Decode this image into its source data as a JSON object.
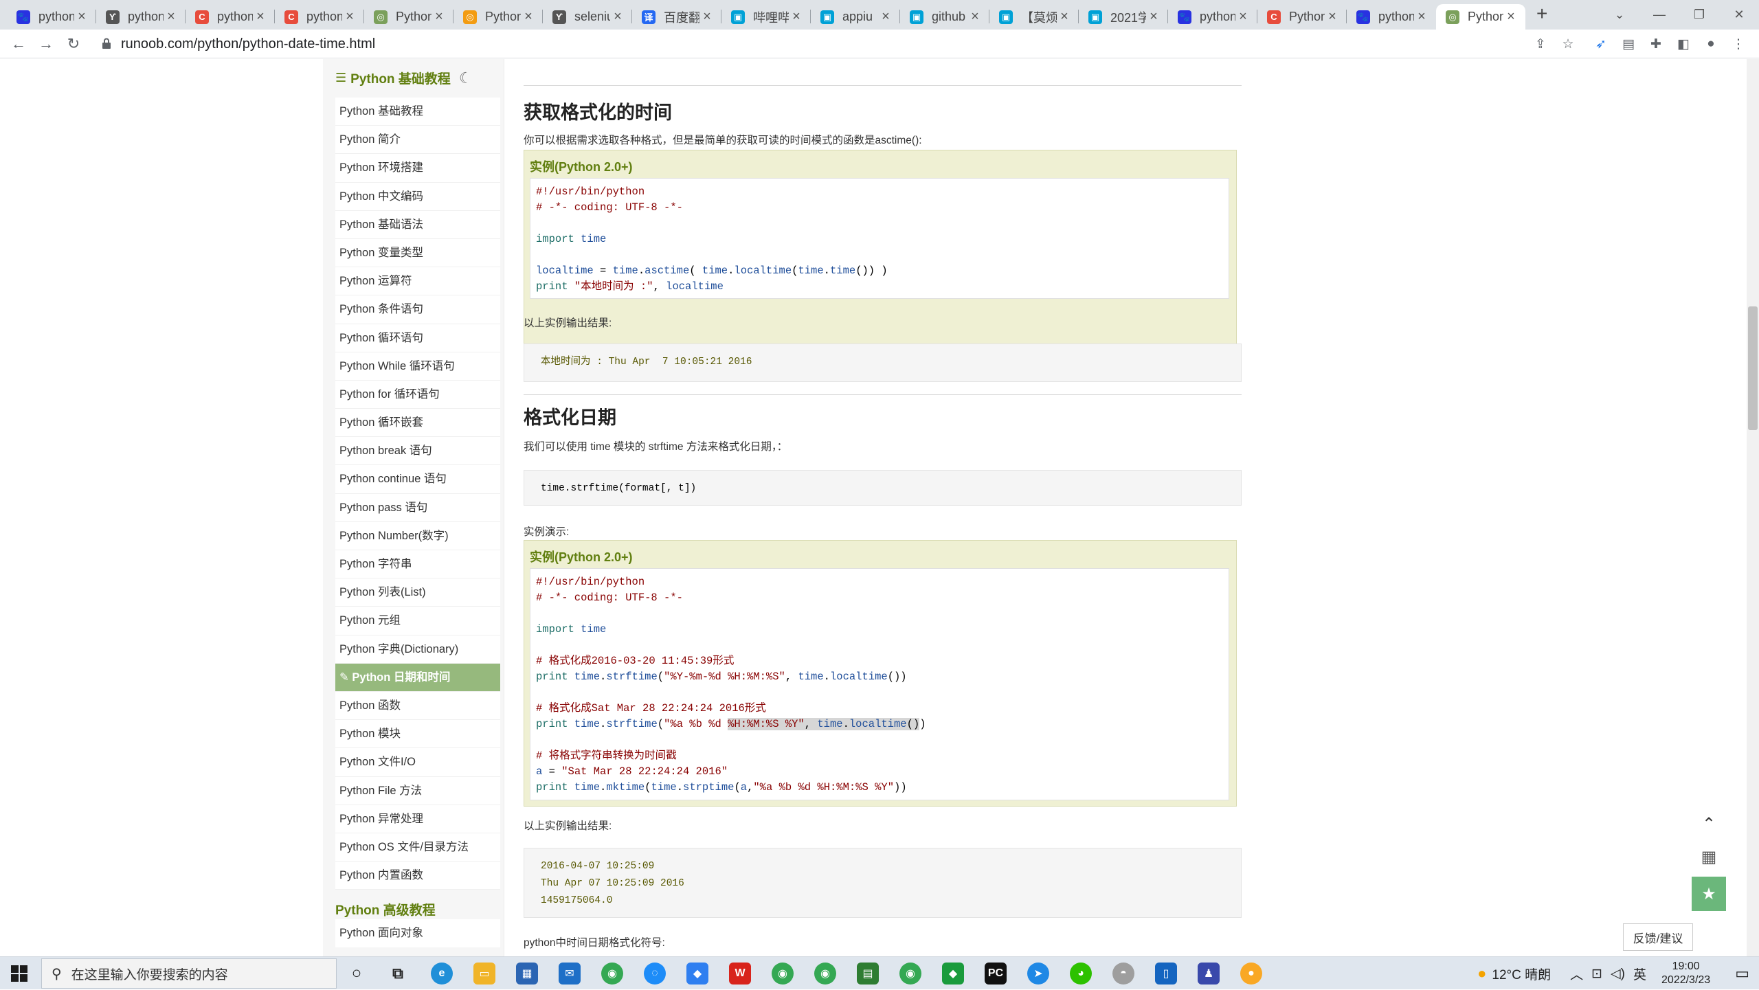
{
  "tabs": [
    {
      "title": "python",
      "fav": "baidu-paw-icon",
      "color": "#2932e1",
      "glyph": "🐾"
    },
    {
      "title": "python",
      "fav": "user-icon",
      "color": "#555555",
      "glyph": "ϒ"
    },
    {
      "title": "python",
      "fav": "c-logo-icon",
      "color": "#e74c3c",
      "glyph": "C"
    },
    {
      "title": "python",
      "fav": "c-logo-icon",
      "color": "#e74c3c",
      "glyph": "C"
    },
    {
      "title": "Python",
      "fav": "runoob-icon",
      "color": "#7ba05b",
      "glyph": "◎"
    },
    {
      "title": "Python",
      "fav": "fire-icon",
      "color": "#f39c12",
      "glyph": "◎"
    },
    {
      "title": "seleniu",
      "fav": "user-icon",
      "color": "#555555",
      "glyph": "ϒ"
    },
    {
      "title": "百度翻",
      "fav": "translate-icon",
      "color": "#2468f2",
      "glyph": "译"
    },
    {
      "title": "哔哩哔",
      "fav": "bilibili-icon",
      "color": "#00a1d6",
      "glyph": "▣"
    },
    {
      "title": "appiu",
      "fav": "bilibili-icon",
      "color": "#00a1d6",
      "glyph": "▣"
    },
    {
      "title": "github",
      "fav": "bilibili-icon",
      "color": "#00a1d6",
      "glyph": "▣"
    },
    {
      "title": "【莫烦",
      "fav": "bilibili-icon",
      "color": "#00a1d6",
      "glyph": "▣"
    },
    {
      "title": "2021学",
      "fav": "bilibili-icon",
      "color": "#00a1d6",
      "glyph": "▣"
    },
    {
      "title": "python",
      "fav": "baidu-paw-icon",
      "color": "#2932e1",
      "glyph": "🐾"
    },
    {
      "title": "Python",
      "fav": "c-logo-icon",
      "color": "#e74c3c",
      "glyph": "C"
    },
    {
      "title": "python",
      "fav": "baidu-paw-icon",
      "color": "#2932e1",
      "glyph": "🐾"
    },
    {
      "title": "Python",
      "fav": "runoob-icon",
      "color": "#7ba05b",
      "glyph": "◎",
      "active": true
    }
  ],
  "url": "runoob.com/python/python-date-time.html",
  "sidebar": {
    "heading": "Python 基础教程",
    "items": [
      "Python 基础教程",
      "Python 简介",
      "Python 环境搭建",
      "Python 中文编码",
      "Python 基础语法",
      "Python 变量类型",
      "Python 运算符",
      "Python 条件语句",
      "Python 循环语句",
      "Python While 循环语句",
      "Python for 循环语句",
      "Python 循环嵌套",
      "Python break 语句",
      "Python continue 语句",
      "Python pass 语句",
      "Python Number(数字)",
      "Python 字符串",
      "Python 列表(List)",
      "Python 元组",
      "Python 字典(Dictionary)",
      "Python 日期和时间",
      "Python 函数",
      "Python 模块",
      "Python 文件I/O",
      "Python File 方法",
      "Python 异常处理",
      "Python OS 文件/目录方法",
      "Python 内置函数"
    ],
    "active_index": 20,
    "advanced_heading": "Python 高级教程",
    "advanced_first": "Python 面向对象"
  },
  "content": {
    "h_format_time": "获取格式化的时间",
    "p_format_time": "你可以根据需求选取各种格式，但是最简单的获取可读的时间模式的函数是asctime():",
    "example_label": "实例(Python 2.0+)",
    "code1": [
      [
        {
          "t": "#!/usr/bin/python",
          "c": "cm"
        }
      ],
      [
        {
          "t": "# -*- coding: UTF-8 -*-",
          "c": "cm"
        }
      ],
      [
        {
          "t": ""
        }
      ],
      [
        {
          "t": "import",
          "c": "kw"
        },
        {
          "t": " "
        },
        {
          "t": "time",
          "c": "fn"
        }
      ],
      [
        {
          "t": ""
        }
      ],
      [
        {
          "t": "localtime",
          "c": "fn"
        },
        {
          "t": " = "
        },
        {
          "t": "time",
          "c": "fn"
        },
        {
          "t": "."
        },
        {
          "t": "asctime",
          "c": "fn"
        },
        {
          "t": "( "
        },
        {
          "t": "time",
          "c": "fn"
        },
        {
          "t": "."
        },
        {
          "t": "localtime",
          "c": "fn"
        },
        {
          "t": "("
        },
        {
          "t": "time",
          "c": "fn"
        },
        {
          "t": "."
        },
        {
          "t": "time",
          "c": "fn"
        },
        {
          "t": "()) )"
        }
      ],
      [
        {
          "t": "print",
          "c": "kw"
        },
        {
          "t": " "
        },
        {
          "t": "\"本地时间为 :\"",
          "c": "st"
        },
        {
          "t": ", "
        },
        {
          "t": "localtime",
          "c": "fn"
        }
      ]
    ],
    "output_label": "以上实例输出结果:",
    "output1": [
      "本地时间为 : Thu Apr  7 10:05:21 2016"
    ],
    "h_format_date": "格式化日期",
    "p_format_date": "我们可以使用 time 模块的 strftime 方法来格式化日期，：",
    "syntax": "time.strftime(format[, t])",
    "demo_label": "实例演示:",
    "code2": [
      [
        {
          "t": "#!/usr/bin/python",
          "c": "cm"
        }
      ],
      [
        {
          "t": "# -*- coding: UTF-8 -*-",
          "c": "cm"
        }
      ],
      [
        {
          "t": ""
        }
      ],
      [
        {
          "t": "import",
          "c": "kw"
        },
        {
          "t": " "
        },
        {
          "t": "time",
          "c": "fn"
        }
      ],
      [
        {
          "t": ""
        }
      ],
      [
        {
          "t": "# 格式化成2016-03-20 11:45:39形式",
          "c": "cm"
        }
      ],
      [
        {
          "t": "print",
          "c": "kw"
        },
        {
          "t": " "
        },
        {
          "t": "time",
          "c": "fn"
        },
        {
          "t": "."
        },
        {
          "t": "strftime",
          "c": "fn"
        },
        {
          "t": "("
        },
        {
          "t": "\"%Y-%m-%d %H:%M:%S\"",
          "c": "st"
        },
        {
          "t": ", "
        },
        {
          "t": "time",
          "c": "fn"
        },
        {
          "t": "."
        },
        {
          "t": "localtime",
          "c": "fn"
        },
        {
          "t": "())"
        }
      ],
      [
        {
          "t": ""
        }
      ],
      [
        {
          "t": "# 格式化成Sat Mar 28 22:24:24 2016形式",
          "c": "cm"
        }
      ],
      [
        {
          "t": "print",
          "c": "kw"
        },
        {
          "t": " "
        },
        {
          "t": "time",
          "c": "fn"
        },
        {
          "t": "."
        },
        {
          "t": "strftime",
          "c": "fn"
        },
        {
          "t": "("
        },
        {
          "t": "\"%a %b %d ",
          "c": "st"
        },
        {
          "t": "%H:%M:%S %Y\"",
          "c": "st hl"
        },
        {
          "t": ", ",
          "c": "hl"
        },
        {
          "t": "time",
          "c": "fn hl"
        },
        {
          "t": ".",
          "c": "hl"
        },
        {
          "t": "localtime",
          "c": "fn hl"
        },
        {
          "t": "()",
          "c": "hl"
        },
        {
          "t": ")"
        }
      ],
      [
        {
          "t": ""
        }
      ],
      [
        {
          "t": "# 将格式字符串转换为时间戳",
          "c": "cm"
        }
      ],
      [
        {
          "t": "a",
          "c": "fn"
        },
        {
          "t": " = "
        },
        {
          "t": "\"Sat Mar 28 22:24:24 2016\"",
          "c": "st"
        }
      ],
      [
        {
          "t": "print",
          "c": "kw"
        },
        {
          "t": " "
        },
        {
          "t": "time",
          "c": "fn"
        },
        {
          "t": "."
        },
        {
          "t": "mktime",
          "c": "fn"
        },
        {
          "t": "("
        },
        {
          "t": "time",
          "c": "fn"
        },
        {
          "t": "."
        },
        {
          "t": "strptime",
          "c": "fn"
        },
        {
          "t": "("
        },
        {
          "t": "a",
          "c": "fn"
        },
        {
          "t": ","
        },
        {
          "t": "\"%a %b %d %H:%M:%S %Y\"",
          "c": "st"
        },
        {
          "t": "))"
        }
      ]
    ],
    "output2": [
      "2016-04-07 10:25:09",
      "Thu Apr 07 10:25:09 2016",
      "1459175064.0"
    ],
    "p_symbols": "python中时间日期格式化符号:"
  },
  "feedback": "反馈/建议",
  "taskbar": {
    "search_placeholder": "在这里输入你要搜索的内容",
    "weather": "12°C  晴朗",
    "ime": "英",
    "time": "19:00",
    "date": "2022/3/23"
  }
}
